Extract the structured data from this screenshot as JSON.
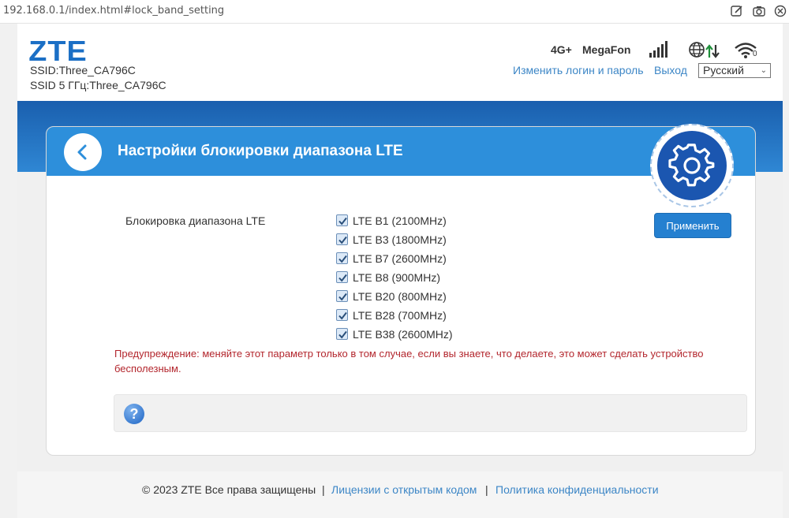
{
  "browser": {
    "url": "192.168.0.1/index.html#lock_band_setting",
    "icons": [
      "edit-page-icon",
      "camera-icon",
      "close-circle-icon"
    ]
  },
  "header": {
    "logo": "ZTE",
    "ssid": "SSID:Three_CA796C",
    "ssid5": "SSID 5 ГГц:Three_CA796C",
    "network_type": "4G+",
    "operator": "MegaFon",
    "wifi_clients": "0",
    "change_login_link": "Изменить логин и пароль",
    "logout_link": "Выход",
    "language": "Русский"
  },
  "page": {
    "title": "Настройки блокировки диапазона LTE",
    "field_label": "Блокировка диапазона LTE",
    "bands": [
      {
        "label": "LTE B1 (2100MHz)",
        "checked": true
      },
      {
        "label": "LTE B3 (1800MHz)",
        "checked": true
      },
      {
        "label": "LTE B7 (2600MHz)",
        "checked": true
      },
      {
        "label": "LTE B8 (900MHz)",
        "checked": true
      },
      {
        "label": "LTE B20 (800MHz)",
        "checked": true
      },
      {
        "label": "LTE B28 (700MHz)",
        "checked": true
      },
      {
        "label": "LTE B38 (2600MHz)",
        "checked": true
      }
    ],
    "apply_button": "Применить",
    "warning": "Предупреждение: меняйте этот параметр только в том случае, если вы знаете, что делаете, это может сделать устройство бесполезным.",
    "help_icon": "?"
  },
  "footer": {
    "copyright": "© 2023 ZTE Все права защищены",
    "separator": "|",
    "opensource_link": "Лицензии с открытым кодом",
    "privacy_link": "Политика конфиденциальности"
  },
  "colors": {
    "brand_blue": "#1b6fc5",
    "header_blue": "#2d8fdb",
    "link_blue": "#3c86c6",
    "warning_red": "#b3262d"
  }
}
